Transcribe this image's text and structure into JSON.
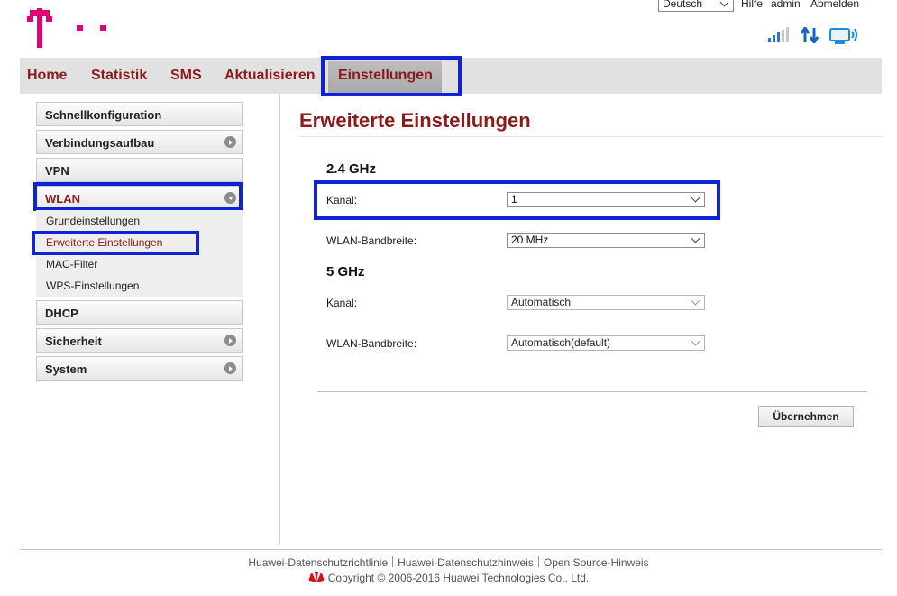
{
  "header": {
    "language": "Deutsch",
    "links": [
      "Hilfe",
      "admin",
      "Abmelden"
    ],
    "brand_color": "#e20074"
  },
  "nav": {
    "items": [
      "Home",
      "Statistik",
      "SMS",
      "Aktualisieren",
      "Einstellungen"
    ],
    "active": "Einstellungen"
  },
  "sidebar": {
    "items": [
      {
        "label": "Schnellkonfiguration"
      },
      {
        "label": "Verbindungsaufbau"
      },
      {
        "label": "VPN"
      },
      {
        "label": "WLAN"
      },
      {
        "label": "DHCP"
      },
      {
        "label": "Sicherheit"
      },
      {
        "label": "System"
      }
    ],
    "wlan_sub": [
      "Grundeinstellungen",
      "Erweiterte Einstellungen",
      "MAC-Filter",
      "WPS-Einstellungen"
    ]
  },
  "main": {
    "title": "Erweiterte Einstellungen",
    "band24": {
      "heading": "2.4 GHz",
      "channel_label": "Kanal:",
      "channel_value": "1",
      "bandwidth_label": "WLAN-Bandbreite:",
      "bandwidth_value": "20 MHz"
    },
    "band5": {
      "heading": "5 GHz",
      "channel_label": "Kanal:",
      "channel_value": "Automatisch",
      "bandwidth_label": "WLAN-Bandbreite:",
      "bandwidth_value": "Automatisch(default)"
    },
    "apply_label": "Übernehmen"
  },
  "footer": {
    "links": [
      "Huawei-Datenschutzrichtlinie",
      "Huawei-Datenschutzhinweis",
      "Open Source-Hinweis"
    ],
    "copyright": "Copyright © 2006-2016 Huawei Technologies Co., Ltd."
  },
  "colors": {
    "accent": "#8b1b1b",
    "highlight": "#1022d8",
    "nav_bg": "#e1e1e1"
  }
}
